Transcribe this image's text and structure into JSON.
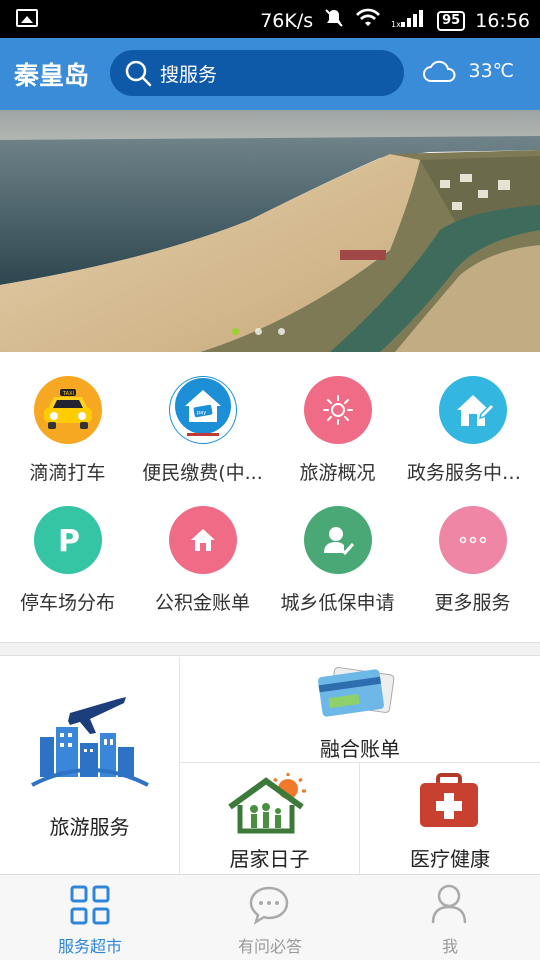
{
  "status": {
    "speed": "76K/s",
    "battery": "95",
    "time": "16:56"
  },
  "header": {
    "city": "秦皇岛",
    "search_placeholder": "搜服务",
    "temperature": "33℃"
  },
  "banner": {
    "page_count": 3,
    "active": 0
  },
  "services": [
    {
      "label": "滴滴打车",
      "icon": "taxi-icon"
    },
    {
      "label": "便民缴费(中...",
      "icon": "pay-house-icon"
    },
    {
      "label": "旅游概况",
      "icon": "sun-icon"
    },
    {
      "label": "政务服务中心...",
      "icon": "gov-house-icon"
    },
    {
      "label": "停车场分布",
      "icon": "parking-icon"
    },
    {
      "label": "公积金账单",
      "icon": "home-icon"
    },
    {
      "label": "城乡低保申请",
      "icon": "person-check-icon"
    },
    {
      "label": "更多服务",
      "icon": "more-icon"
    }
  ],
  "tiles": {
    "travel": "旅游服务",
    "bill": "融合账单",
    "home": "居家日子",
    "medical": "医疗健康"
  },
  "tabs": [
    {
      "label": "服务超市",
      "active": true
    },
    {
      "label": "有问必答",
      "active": false
    },
    {
      "label": "我",
      "active": false
    }
  ],
  "colors": {
    "primary": "#3a8bd8",
    "search_bg": "#0f5aa8",
    "pink": "#ef6b86",
    "teal": "#35c4a4",
    "green": "#4aa876",
    "cyan": "#33b7e0"
  }
}
